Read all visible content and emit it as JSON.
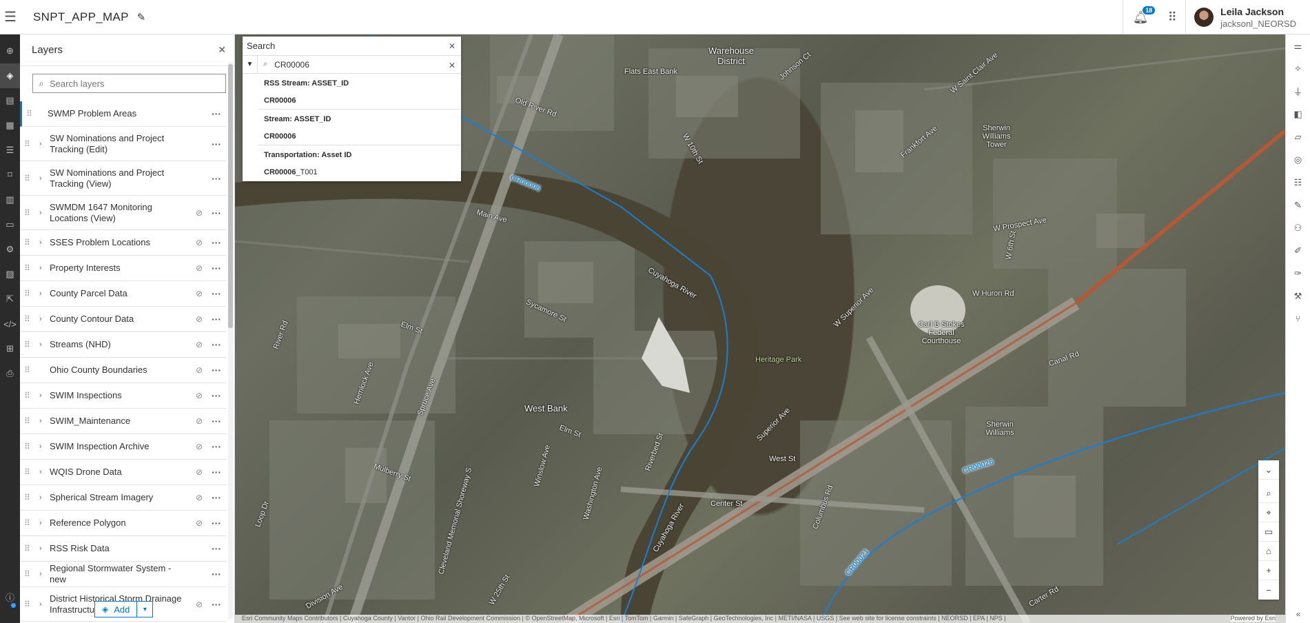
{
  "header": {
    "app_title": "SNPT_APP_MAP",
    "notification_count": "18",
    "user_name": "Leila Jackson",
    "user_login": "jacksonl_NEORSD"
  },
  "layers_panel": {
    "title": "Layers",
    "search_placeholder": "Search layers",
    "add_label": "Add",
    "items": [
      {
        "label": "SWMP Problem Areas"
      },
      {
        "label": "SW Nominations and Project Tracking (Edit)"
      },
      {
        "label": "SW Nominations and Project Tracking (View)"
      },
      {
        "label": "SWMDM 1647 Monitoring Locations (View)"
      },
      {
        "label": "SSES Problem Locations"
      },
      {
        "label": "Property Interests"
      },
      {
        "label": "County Parcel Data"
      },
      {
        "label": "County Contour Data"
      },
      {
        "label": "Streams (NHD)"
      },
      {
        "label": "Ohio County Boundaries"
      },
      {
        "label": "SWIM Inspections"
      },
      {
        "label": "SWIM_Maintenance"
      },
      {
        "label": "SWIM Inspection Archive"
      },
      {
        "label": "WQIS Drone Data"
      },
      {
        "label": "Spherical Stream Imagery"
      },
      {
        "label": "Reference Polygon"
      },
      {
        "label": "RSS Risk Data"
      },
      {
        "label": "Regional Stormwater System - new"
      },
      {
        "label": "District Historical Storm Drainage Infrastructure"
      }
    ]
  },
  "search": {
    "title": "Search",
    "value": "CR00006",
    "results": [
      {
        "group": "RSS Stream: ASSET_ID",
        "match": "CR00006",
        "suffix": ""
      },
      {
        "group": "Stream: ASSET_ID",
        "match": "CR00006",
        "suffix": ""
      },
      {
        "group": "Transportation: Asset ID",
        "match": "CR00006",
        "suffix": "_T001"
      }
    ]
  },
  "map_labels": {
    "warehouse": "Warehouse District",
    "flats": "Flats East Bank",
    "west_bank": "West Bank",
    "heritage": "Heritage Park",
    "cuyahoga1": "Cuyahoga River",
    "cuyahoga2": "Cuyahoga River",
    "federal": "Carl B Stokes Federal Courthouse",
    "sherwin1": "Sherwin Williams Tower",
    "sherwin2": "Sherwin Williams",
    "stream1": "CR00006",
    "stream2": "CR00026",
    "stream3": "CR00021",
    "main_ave": "Main Ave",
    "elm_st": "Elm St",
    "center_st": "Center St",
    "superior": "Superior Ave",
    "w_superior": "W Superior Ave",
    "old_river": "Old River Rd",
    "sycamore": "Sycamore St",
    "canal_rd": "Canal Rd",
    "w_huron": "W Huron Rd",
    "w_prospect": "W Prospect Ave",
    "w_st_clair": "W Saint Clair Ave",
    "frankfort": "Frankfort Ave",
    "johnson": "Johnson Ct",
    "w_10th": "W 10th St",
    "w_6th": "W 6th St",
    "river_rd": "River Rd",
    "mulberry": "Mulberry St",
    "division": "Division Ave",
    "loop_dr": "Loop Dr",
    "hemlock": "Hemlock Ave",
    "spruce": "Spruce Ave",
    "washington": "Washington Ave",
    "winslow": "Winslow Ave",
    "cleveland_mem": "Cleveland Memorial Shoreway S",
    "columbus": "Columbus Rd",
    "west_st": "West St",
    "riverbed": "Riverbed St",
    "carter": "Carter Rd",
    "w_25th": "W 25th St",
    "attribution": "Esri Community Maps Contributors | Cuyahoga County | Vantor | Ohio Rail Development Commission | © OpenStreetMap, Microsoft | Esri | TomTom | Garmin | SafeGraph | GeoTechnologies, Inc | METI/NASA | USGS | See web site for license constraints | NEORSD | EPA | NPS |",
    "powered_by": "Powered by Esri"
  },
  "colors": {
    "accent": "#007ac2",
    "toolbar_dark": "#2b2b2b",
    "stream_line": "#1a7fd1"
  },
  "icons": {
    "menu": "hamburger-icon",
    "edit": "pencil-icon",
    "bell": "bell-icon",
    "apps": "grid-icon"
  }
}
